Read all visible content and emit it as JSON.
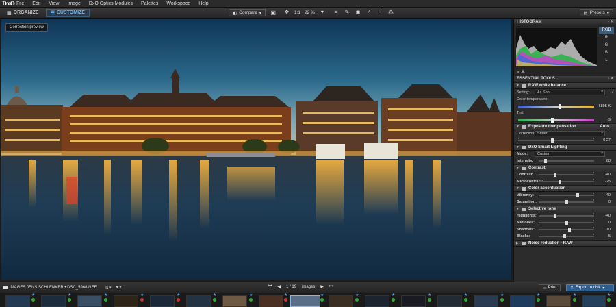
{
  "app": {
    "logo": "DxO",
    "menu": [
      "File",
      "Edit",
      "View",
      "Image",
      "DxO Optics Modules",
      "Palettes",
      "Workspace",
      "Help"
    ]
  },
  "toolbar": {
    "organize": "ORGANIZE",
    "customize": "CUSTOMIZE",
    "compare": "Compare",
    "zoom_one": "1:1",
    "zoom_level": "22 %",
    "presets": "Presets"
  },
  "preview": {
    "badge": "Correction preview"
  },
  "histogram": {
    "title": "HISTOGRAM",
    "channels": [
      "RGB",
      "R",
      "G",
      "B",
      "L"
    ],
    "selected_channel": "RGB"
  },
  "essential": {
    "title": "ESSENTIAL TOOLS",
    "white_balance": {
      "title": "RAW white balance",
      "setting_label": "Setting:",
      "setting_value": "As Shot",
      "temp_label": "Color temperature:",
      "temp_value": "6895 K",
      "temp_level": 0.55,
      "tint_label": "Tint:",
      "tint_value": "-9",
      "tint_level": 0.45
    },
    "exposure": {
      "title": "Exposure compensation",
      "auto": "Auto",
      "correction_label": "Correction:",
      "correction_value": "Smart",
      "value": "-0.27",
      "level": 0.45
    },
    "smart_lighting": {
      "title": "DxO Smart Lighting",
      "mode_label": "Mode:",
      "mode_value": "Custom",
      "intensity_label": "Intensity:",
      "intensity_value": "68",
      "intensity_level": 0.12
    },
    "contrast": {
      "title": "Contrast",
      "contrast_label": "Contrast:",
      "contrast_value": "-40",
      "contrast_level": 0.3,
      "micro_label": "Microcontrast:",
      "micro_value": "-25",
      "micro_level": 0.38
    },
    "color_accent": {
      "title": "Color accentuation",
      "vibrancy_label": "Vibrancy:",
      "vibrancy_value": "40",
      "vibrancy_level": 0.7,
      "saturation_label": "Saturation:",
      "saturation_value": "0",
      "saturation_level": 0.5
    },
    "selective_tone": {
      "title": "Selective tone",
      "highlights_label": "Highlights:",
      "highlights_value": "-40",
      "highlights_level": 0.3,
      "midtones_label": "Midtones:",
      "midtones_value": "0",
      "midtones_level": 0.5,
      "shadows_label": "Shadows:",
      "shadows_value": "10",
      "shadows_level": 0.55,
      "blacks_label": "Blacks:",
      "blacks_value": "-5",
      "blacks_level": 0.47
    },
    "noise": {
      "title": "Noise reduction - RAW"
    }
  },
  "bottombar": {
    "path": "IMAGES JENS SCHLENKER • DSC_5968.NEF",
    "counter": "1 / 19",
    "counter_label": "images",
    "print": "Print",
    "export": "Export to disk"
  }
}
